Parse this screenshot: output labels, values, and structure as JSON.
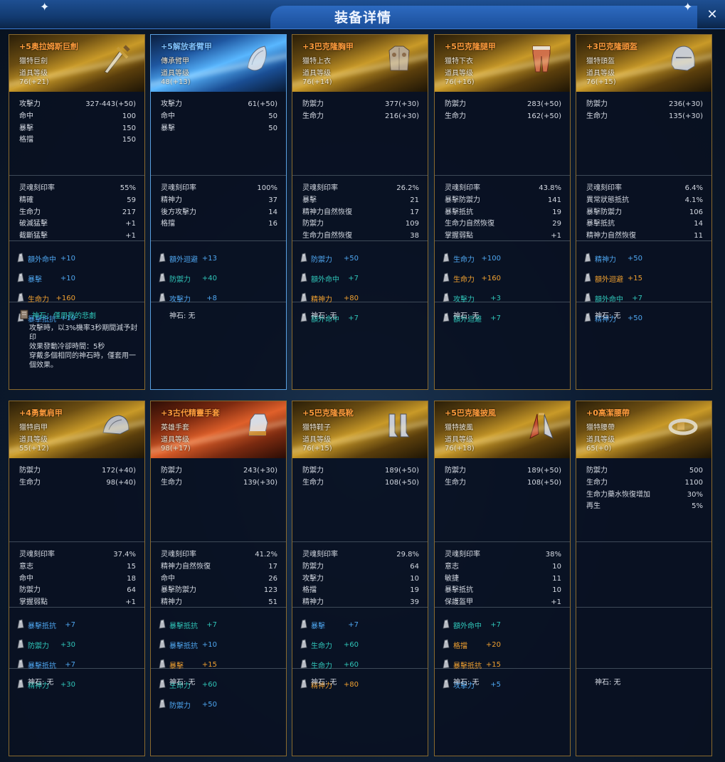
{
  "window": {
    "title": "装备详情"
  },
  "gems_empty_label": "神石: 无",
  "cards": [
    {
      "name": "+5奥拉姆斯巨劍",
      "type": "獵特巨劍",
      "level_label": "道具等级",
      "level": "76(+21)",
      "theme": "gold",
      "name_color": "orange",
      "icon": "sword-icon",
      "base": [
        [
          "攻擊力",
          "327-443(+50)"
        ],
        [
          "命中",
          "100"
        ],
        [
          "暴擊",
          "150"
        ],
        [
          "格擋",
          "150"
        ]
      ],
      "soul": [
        [
          "灵魂刻印率",
          "55%"
        ],
        [
          "精確",
          "59"
        ],
        [
          "生命力",
          "217"
        ],
        [
          "破滅猛擊",
          "+1"
        ],
        [
          "截斷猛擊",
          "+1"
        ]
      ],
      "gems": [
        [
          "額外命中",
          "+10",
          "blue"
        ],
        [
          "暴擊",
          "+10",
          "blue"
        ],
        [
          "生命力",
          "+160",
          "orange"
        ],
        [
          "暴擊抵抗",
          "+10",
          "blue"
        ]
      ],
      "stone": {
        "title": "神石：僅用我的悲劇",
        "lines": [
          "攻擊時，以3%機率3秒期間減予封",
          "印",
          "效果發動冷卻時間：5秒",
          "穿戴多個相同的神石時，僅套用一",
          "個效果。"
        ]
      }
    },
    {
      "name": "+5解放者臂甲",
      "type": "傳承臂甲",
      "level_label": "道具等级",
      "level": "48(+13)",
      "theme": "blue",
      "name_color": "blue",
      "icon": "armguard-icon",
      "base": [
        [
          "攻擊力",
          "61(+50)"
        ],
        [
          "命中",
          "50"
        ],
        [
          "暴擊",
          "50"
        ]
      ],
      "soul": [
        [
          "灵魂刻印率",
          "100%"
        ],
        [
          "精神力",
          "37"
        ],
        [
          "後方攻擊力",
          "14"
        ],
        [
          "格擋",
          "16"
        ]
      ],
      "gems": [
        [
          "額外迴避",
          "+13",
          "blue"
        ],
        [
          "防禦力",
          "+40",
          "teal"
        ],
        [
          "攻擊力",
          "+8",
          "blue"
        ]
      ],
      "stone": null
    },
    {
      "name": "+3巴克隆胸甲",
      "type": "獵特上衣",
      "level_label": "道具等级",
      "level": "76(+14)",
      "theme": "gold",
      "name_color": "orange",
      "icon": "chest-armor-icon",
      "base": [
        [
          "防禦力",
          "377(+30)"
        ],
        [
          "生命力",
          "216(+30)"
        ]
      ],
      "soul": [
        [
          "灵魂刻印率",
          "26.2%"
        ],
        [
          "暴擊",
          "21"
        ],
        [
          "精神力自然恢復",
          "17"
        ],
        [
          "防禦力",
          "109"
        ],
        [
          "生命力自然恢復",
          "38"
        ]
      ],
      "gems": [
        [
          "防禦力",
          "+50",
          "blue"
        ],
        [
          "額外命中",
          "+7",
          "teal"
        ],
        [
          "精神力",
          "+80",
          "orange"
        ],
        [
          "額外命中",
          "+7",
          "teal"
        ]
      ],
      "stone": null
    },
    {
      "name": "+5巴克隆腿甲",
      "type": "獵特下衣",
      "level_label": "道具等级",
      "level": "76(+16)",
      "theme": "gold",
      "name_color": "orange",
      "icon": "leg-armor-icon",
      "base": [
        [
          "防禦力",
          "283(+50)"
        ],
        [
          "生命力",
          "162(+50)"
        ]
      ],
      "soul": [
        [
          "灵魂刻印率",
          "43.8%"
        ],
        [
          "暴擊防禦力",
          "141"
        ],
        [
          "暴擊抵抗",
          "19"
        ],
        [
          "生命力自然恢復",
          "29"
        ],
        [
          "掌握弱點",
          "+1"
        ]
      ],
      "gems": [
        [
          "生命力",
          "+100",
          "blue"
        ],
        [
          "生命力",
          "+160",
          "orange"
        ],
        [
          "攻擊力",
          "+3",
          "teal"
        ],
        [
          "額外迴避",
          "+7",
          "teal"
        ]
      ],
      "stone": null
    },
    {
      "name": "+3巴克隆頭盔",
      "type": "獵特頭盔",
      "level_label": "道具等级",
      "level": "76(+15)",
      "theme": "gold",
      "name_color": "orange",
      "icon": "helmet-icon",
      "base": [
        [
          "防禦力",
          "236(+30)"
        ],
        [
          "生命力",
          "135(+30)"
        ]
      ],
      "soul": [
        [
          "灵魂刻印率",
          "6.4%"
        ],
        [
          "異常狀態抵抗",
          "4.1%"
        ],
        [
          "暴擊防禦力",
          "106"
        ],
        [
          "暴擊抵抗",
          "14"
        ],
        [
          "精神力自然恢復",
          "11"
        ]
      ],
      "gems": [
        [
          "精神力",
          "+50",
          "blue"
        ],
        [
          "額外迴避",
          "+15",
          "orange"
        ],
        [
          "額外命中",
          "+7",
          "teal"
        ],
        [
          "精神力",
          "+50",
          "blue"
        ]
      ],
      "stone": null
    },
    {
      "name": "+4勇氣肩甲",
      "type": "獵特肩甲",
      "level_label": "道具等级",
      "level": "55(+12)",
      "theme": "gold",
      "name_color": "orange",
      "icon": "shoulder-armor-icon",
      "base": [
        [
          "防禦力",
          "172(+40)"
        ],
        [
          "生命力",
          "98(+40)"
        ]
      ],
      "soul": [
        [
          "灵魂刻印率",
          "37.4%"
        ],
        [
          "意志",
          "15"
        ],
        [
          "命中",
          "18"
        ],
        [
          "防禦力",
          "64"
        ],
        [
          "掌握弱點",
          "+1"
        ]
      ],
      "gems": [
        [
          "暴擊抵抗",
          "+7",
          "blue"
        ],
        [
          "防禦力",
          "+30",
          "teal"
        ],
        [
          "暴擊抵抗",
          "+7",
          "blue"
        ],
        [
          "精神力",
          "+30",
          "teal"
        ]
      ],
      "stone": null
    },
    {
      "name": "+3古代精靈手套",
      "type": "英雄手套",
      "level_label": "道具等级",
      "level": "98(+17)",
      "theme": "red",
      "name_color": "orange",
      "icon": "gauntlet-icon",
      "base": [
        [
          "防禦力",
          "243(+30)"
        ],
        [
          "生命力",
          "139(+30)"
        ]
      ],
      "soul": [
        [
          "灵魂刻印率",
          "41.2%"
        ],
        [
          "精神力自然恢復",
          "17"
        ],
        [
          "命中",
          "26"
        ],
        [
          "暴擊防禦力",
          "123"
        ],
        [
          "精神力",
          "51"
        ]
      ],
      "gems": [
        [
          "暴擊抵抗",
          "+7",
          "teal"
        ],
        [
          "暴擊抵抗",
          "+10",
          "blue"
        ],
        [
          "暴擊",
          "+15",
          "orange"
        ],
        [
          "生命力",
          "+60",
          "teal"
        ],
        [
          "防禦力",
          "+50",
          "blue"
        ]
      ],
      "stone": null
    },
    {
      "name": "+5巴克隆長靴",
      "type": "獵特鞋子",
      "level_label": "道具等级",
      "level": "76(+15)",
      "theme": "gold",
      "name_color": "orange",
      "icon": "boots-icon",
      "base": [
        [
          "防禦力",
          "189(+50)"
        ],
        [
          "生命力",
          "108(+50)"
        ]
      ],
      "soul": [
        [
          "灵魂刻印率",
          "29.8%"
        ],
        [
          "防禦力",
          "64"
        ],
        [
          "攻擊力",
          "10"
        ],
        [
          "格擋",
          "19"
        ],
        [
          "精神力",
          "39"
        ]
      ],
      "gems": [
        [
          "暴擊",
          "+7",
          "blue"
        ],
        [
          "生命力",
          "+60",
          "teal"
        ],
        [
          "生命力",
          "+60",
          "teal"
        ],
        [
          "精神力",
          "+80",
          "orange"
        ]
      ],
      "stone": null
    },
    {
      "name": "+5巴克隆披風",
      "type": "獵特披風",
      "level_label": "道具等级",
      "level": "76(+18)",
      "theme": "gold",
      "name_color": "orange",
      "icon": "cloak-icon",
      "base": [
        [
          "防禦力",
          "189(+50)"
        ],
        [
          "生命力",
          "108(+50)"
        ]
      ],
      "soul": [
        [
          "灵魂刻印率",
          "38%"
        ],
        [
          "意志",
          "10"
        ],
        [
          "敏捷",
          "11"
        ],
        [
          "暴擊抵抗",
          "10"
        ],
        [
          "保護盔甲",
          "+1"
        ]
      ],
      "gems": [
        [
          "額外命中",
          "+7",
          "teal"
        ],
        [
          "格擋",
          "+20",
          "orange"
        ],
        [
          "暴擊抵抗",
          "+15",
          "orange"
        ],
        [
          "攻擊力",
          "+5",
          "blue"
        ]
      ],
      "stone": null
    },
    {
      "name": "+0高潔腰帶",
      "type": "獵特腰帶",
      "level_label": "道具等级",
      "level": "65(+0)",
      "theme": "gold",
      "name_color": "orange",
      "icon": "belt-icon",
      "base": [
        [
          "防禦力",
          "500"
        ],
        [
          "生命力",
          "1100"
        ],
        [
          "生命力藥水恢復增加",
          "30%"
        ],
        [
          "再生",
          "5%"
        ]
      ],
      "soul": [],
      "gems": [],
      "stone": null
    }
  ]
}
